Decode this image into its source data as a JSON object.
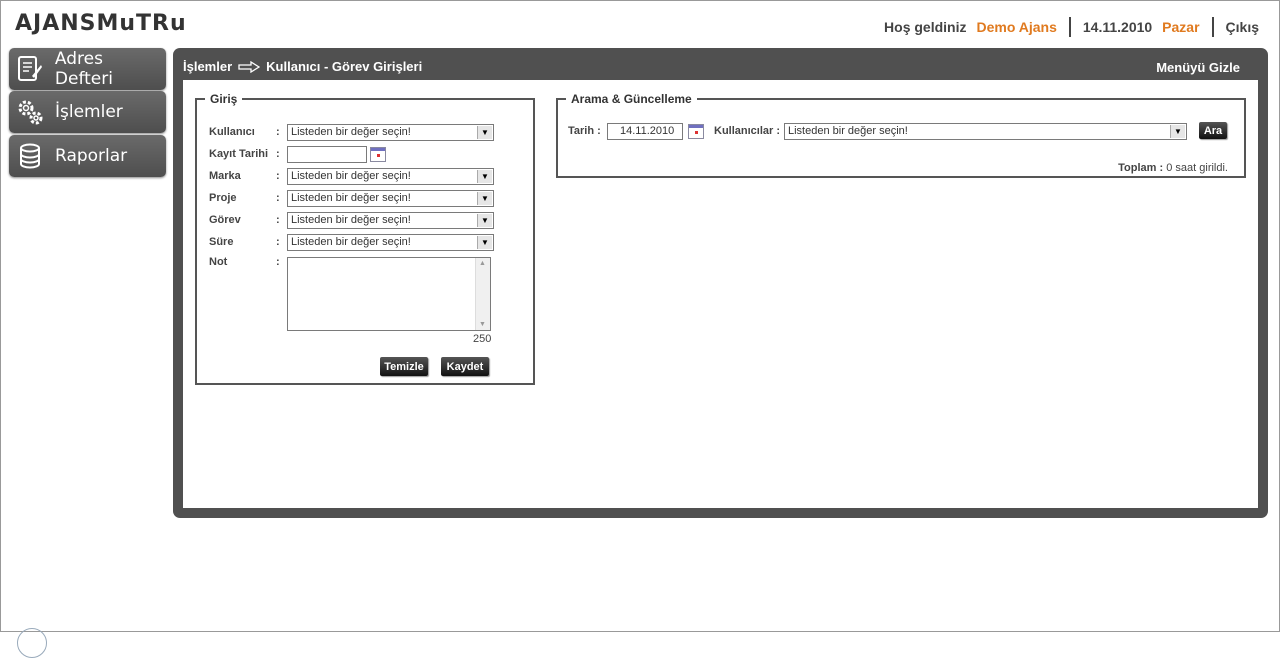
{
  "logo": {
    "text": "AJANSMuTRu"
  },
  "topbar": {
    "welcome": "Hoş geldiniz",
    "org": "Demo Ajans",
    "date": "14.11.2010",
    "day": "Pazar",
    "logout": "Çıkış"
  },
  "sidebar": {
    "items": [
      {
        "label": "Adres Defteri",
        "icon": "address-book-icon"
      },
      {
        "label": "İşlemler",
        "icon": "gears-icon"
      },
      {
        "label": "Raporlar",
        "icon": "database-icon"
      }
    ]
  },
  "panel": {
    "breadcrumb_root": "İşlemler",
    "breadcrumb_page": "Kullanıcı - Görev Girişleri",
    "hide_menu": "Menüyü Gizle"
  },
  "entry": {
    "legend": "Giriş",
    "fields": {
      "user": {
        "label": "Kullanıcı",
        "value": "Listeden bir değer seçin!"
      },
      "date": {
        "label": "Kayıt Tarihi",
        "value": ""
      },
      "brand": {
        "label": "Marka",
        "value": "Listeden bir değer seçin!"
      },
      "project": {
        "label": "Proje",
        "value": "Listeden bir değer seçin!"
      },
      "task": {
        "label": "Görev",
        "value": "Listeden bir değer seçin!"
      },
      "duration": {
        "label": "Süre",
        "value": "Listeden bir değer seçin!"
      },
      "note": {
        "label": "Not",
        "value": ""
      }
    },
    "colon": ":",
    "char_count": "250",
    "clear_label": "Temizle",
    "save_label": "Kaydet"
  },
  "search": {
    "legend": "Arama & Güncelleme",
    "date_label": "Tarih :",
    "date_value": "14.11.2010",
    "users_label": "Kullanıcılar :",
    "users_value": "Listeden bir değer seçin!",
    "search_label": "Ara",
    "total_label": "Toplam :",
    "total_value": "0 saat girildi."
  },
  "colors": {
    "accent": "#e07a1f",
    "panel": "#505050",
    "nav": "#5c5c5c"
  }
}
